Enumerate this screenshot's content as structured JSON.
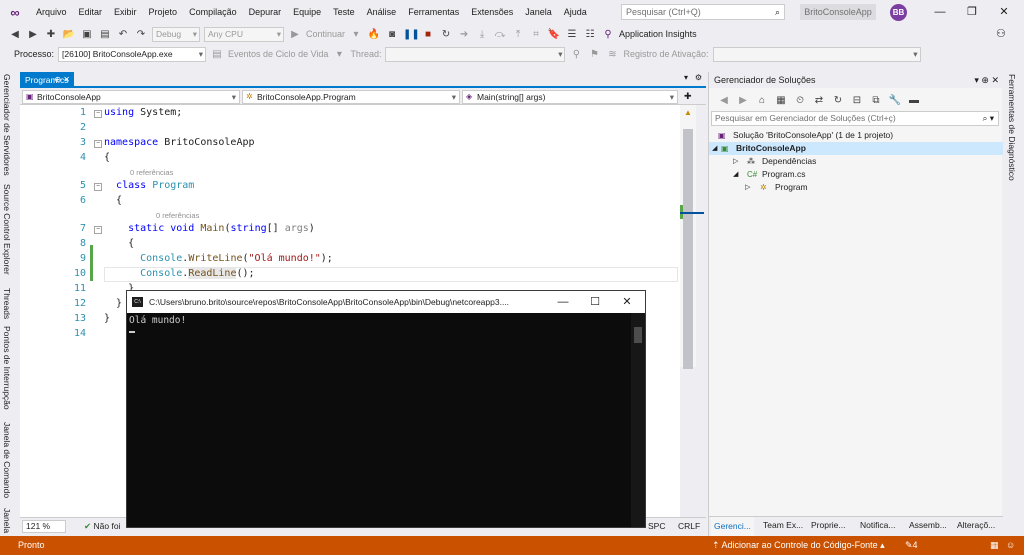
{
  "menu": [
    "Arquivo",
    "Editar",
    "Exibir",
    "Projeto",
    "Compilação",
    "Depurar",
    "Equipe",
    "Teste",
    "Análise",
    "Ferramentas",
    "Extensões",
    "Janela",
    "Ajuda"
  ],
  "search": {
    "placeholder": "Pesquisar (Ctrl+Q)"
  },
  "app_name": "BritoConsoleApp",
  "user_initials": "BB",
  "toolbar": {
    "config": "Debug",
    "platform": "Any CPU",
    "continue": "Continuar",
    "app_insights": "Application Insights"
  },
  "process_bar": {
    "process_label": "Processo:",
    "process_value": "[26100] BritoConsoleApp.exe",
    "lifecycle": "Eventos de Ciclo de Vida",
    "thread_label": "Thread:",
    "stack_label": "Registro de Ativação:"
  },
  "left_tabs": [
    "Gerenciador de Servidores",
    "Source Control Explorer",
    "Threads",
    "Pontos de Interrupção",
    "Janela de Comando",
    "Janela"
  ],
  "right_tabs": [
    "Ferramentas de Diagnóstico"
  ],
  "editor": {
    "tab_name": "Program.cs",
    "nav_project": "BritoConsoleApp",
    "nav_class": "BritoConsoleApp.Program",
    "nav_member": "Main(string[] args)",
    "line_numbers": [
      "1",
      "2",
      "3",
      "4",
      "5",
      "6",
      "7",
      "8",
      "9",
      "10",
      "11",
      "12",
      "13",
      "14"
    ],
    "codelens_refs": "0 referências",
    "code": {
      "l1_kw": "using",
      "l1_rest": " System;",
      "l3_kw": "namespace",
      "l3_rest": " BritoConsoleApp",
      "l4": "{",
      "l5_kw": "class",
      "l5_ty": "Program",
      "l6": "{",
      "l7_kw1": "static",
      "l7_kw2": "void",
      "l7_mt": "Main",
      "l7_kw3": "string",
      "l7_pm": "args",
      "l8": "{",
      "l9_ty": "Console",
      "l9_mt": "WriteLine",
      "l9_st": "\"Olá mundo!\"",
      "l10_ty": "Console",
      "l10_mt": "ReadLine",
      "l11": "}",
      "l12": "}",
      "l13": "}"
    },
    "zoom": "121 %",
    "status_text": "Não foi",
    "spc": "SPC",
    "crlf": "CRLF"
  },
  "console": {
    "title": "C:\\Users\\bruno.brito\\source\\repos\\BritoConsoleApp\\BritoConsoleApp\\bin\\Debug\\netcoreapp3....",
    "output": "Olá mundo!"
  },
  "solution_explorer": {
    "title": "Gerenciador de Soluções",
    "search_placeholder": "Pesquisar em Gerenciador de Soluções (Ctrl+ç)",
    "tree": [
      {
        "label": "Solução 'BritoConsoleApp' (1 de 1 projeto)"
      },
      {
        "label": "BritoConsoleApp"
      },
      {
        "label": "Dependências"
      },
      {
        "label": "Program.cs"
      },
      {
        "label": "Program"
      }
    ],
    "tabs": [
      "Gerenci...",
      "Team Ex...",
      "Proprie...",
      "Notifica...",
      "Assemb...",
      "Alteraçõ..."
    ]
  },
  "status": {
    "left": "Pronto",
    "right": "Adicionar ao Controle do Código-Fonte",
    "badge": "4"
  },
  "colors": {
    "accent": "#007acc",
    "status_debug": "#ca5100",
    "vs_purple": "#68217a"
  }
}
